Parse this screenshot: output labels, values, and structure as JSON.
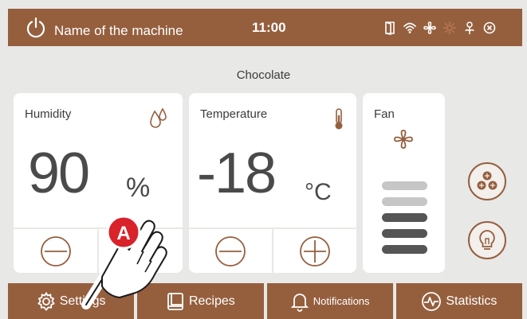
{
  "header": {
    "machine_name": "Name of the machine",
    "time": "11:00",
    "status_icons": [
      "door-icon",
      "wifi-icon",
      "fan-icon",
      "defrost-icon",
      "flower-icon",
      "alarm-icon"
    ]
  },
  "program": {
    "name": "Chocolate"
  },
  "humidity": {
    "title": "Humidity",
    "value": "90",
    "unit": "%"
  },
  "temperature": {
    "title": "Temperature",
    "value": "-18",
    "unit": "°C"
  },
  "fan": {
    "title": "Fan",
    "levels_total": 5,
    "levels_active": 3
  },
  "colors": {
    "accent": "#955f3e",
    "background": "#e8e8e6",
    "card": "#ffffff",
    "fan_level_on": "#555555",
    "fan_level_off": "#c6c6c6"
  },
  "nav": {
    "settings": "Settings",
    "recipes": "Recipes",
    "notifications": "Notifications",
    "statistics": "Statistics"
  },
  "marker": {
    "label": "A"
  }
}
